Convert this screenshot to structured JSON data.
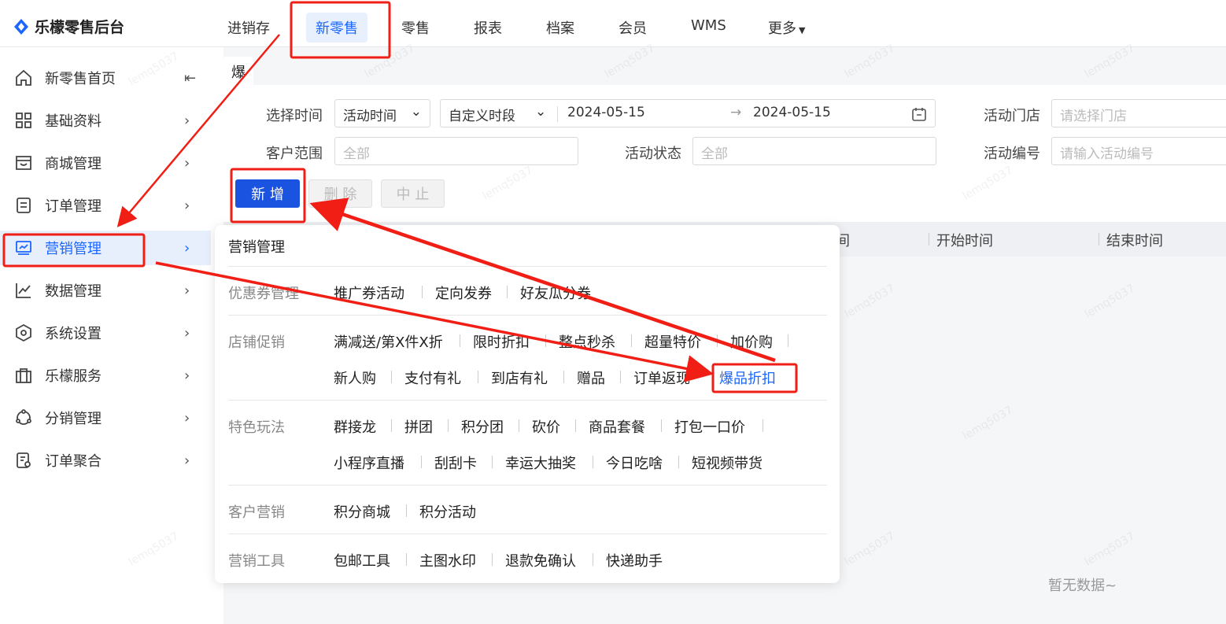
{
  "app": {
    "logo_text": "乐檬零售后台",
    "brand_color": "#1a66ff"
  },
  "topnav": {
    "items": [
      {
        "label": "进销存"
      },
      {
        "label": "新零售"
      },
      {
        "label": "零售"
      },
      {
        "label": "报表"
      },
      {
        "label": "档案"
      },
      {
        "label": "会员"
      },
      {
        "label": "WMS"
      },
      {
        "label": "更多"
      }
    ],
    "active": "新零售"
  },
  "sidebar": {
    "items": [
      {
        "label": "新零售首页",
        "icon": "home-icon"
      },
      {
        "label": "基础资料",
        "icon": "grid-icon"
      },
      {
        "label": "商城管理",
        "icon": "store-icon"
      },
      {
        "label": "订单管理",
        "icon": "order-icon"
      },
      {
        "label": "营销管理",
        "icon": "monitor-icon"
      },
      {
        "label": "数据管理",
        "icon": "chart-icon"
      },
      {
        "label": "系统设置",
        "icon": "settings-icon"
      },
      {
        "label": "乐檬服务",
        "icon": "briefcase-icon"
      },
      {
        "label": "分销管理",
        "icon": "share-icon"
      },
      {
        "label": "订单聚合",
        "icon": "order-aggregate-icon"
      }
    ],
    "active": "营销管理"
  },
  "tab": {
    "label": "爆品折扣"
  },
  "filters": {
    "time_label": "选择时间",
    "time_type": "活动时间",
    "time_range_type": "自定义时段",
    "date_start": "2024-05-15",
    "date_end": "2024-05-15",
    "store_label": "活动门店",
    "store_placeholder": "请选择门店",
    "customer_label": "客户范围",
    "customer_value": "全部",
    "status_label": "活动状态",
    "status_value": "全部",
    "code_label": "活动编号",
    "code_placeholder": "请输入活动编号"
  },
  "buttons": {
    "add": "新 增",
    "delete": "删 除",
    "stop": "中 止"
  },
  "table": {
    "columns": [
      "间",
      "开始时间",
      "结束时间"
    ],
    "empty_text": "暂无数据~"
  },
  "dropdown": {
    "title": "营销管理",
    "groups": [
      {
        "category": "优惠券管理",
        "rows": [
          [
            "推广券活动",
            "定向发券",
            "好友瓜分券"
          ]
        ]
      },
      {
        "category": "店铺促销",
        "rows": [
          [
            "满减送/第X件X折",
            "限时折扣",
            "整点秒杀",
            "超量特价",
            "加价购"
          ],
          [
            "新人购",
            "支付有礼",
            "到店有礼",
            "赠品",
            "订单返现",
            "爆品折扣"
          ]
        ]
      },
      {
        "category": "特色玩法",
        "rows": [
          [
            "群接龙",
            "拼团",
            "积分团",
            "砍价",
            "商品套餐",
            "打包一口价"
          ],
          [
            "小程序直播",
            "刮刮卡",
            "幸运大抽奖",
            "今日吃啥",
            "短视频带货"
          ]
        ]
      },
      {
        "category": "客户营销",
        "rows": [
          [
            "积分商城",
            "积分活动"
          ]
        ]
      },
      {
        "category": "营销工具",
        "rows": [
          [
            "包邮工具",
            "主图水印",
            "退款免确认",
            "快递助手"
          ]
        ]
      }
    ],
    "highlighted": "爆品折扣"
  },
  "watermark": "lemq5037",
  "annotation_color": "#f01e14"
}
